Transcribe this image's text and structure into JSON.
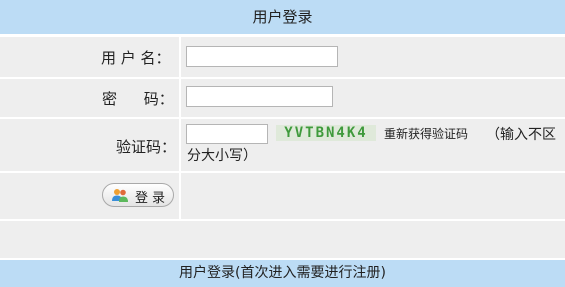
{
  "header": {
    "title": "用户登录"
  },
  "form": {
    "username": {
      "label": "用 户 名：",
      "value": "",
      "placeholder": ""
    },
    "password": {
      "label": "密 码：",
      "value": "",
      "placeholder": ""
    },
    "captcha": {
      "label": "验证码：",
      "value": "",
      "image_text": "YVTBN4K4",
      "refresh_label": "重新获得验证码",
      "hint_line1": "（输入不区",
      "hint_line2": "分大小写）"
    },
    "login_button": {
      "label": "登录",
      "icon": "users-icon"
    }
  },
  "footer": {
    "text": "用户登录(首次进入需要进行注册)"
  },
  "colors": {
    "header_bg": "#bcdcf5",
    "row_bg": "#eeeeee",
    "captcha_text": "#3f9a3c"
  }
}
